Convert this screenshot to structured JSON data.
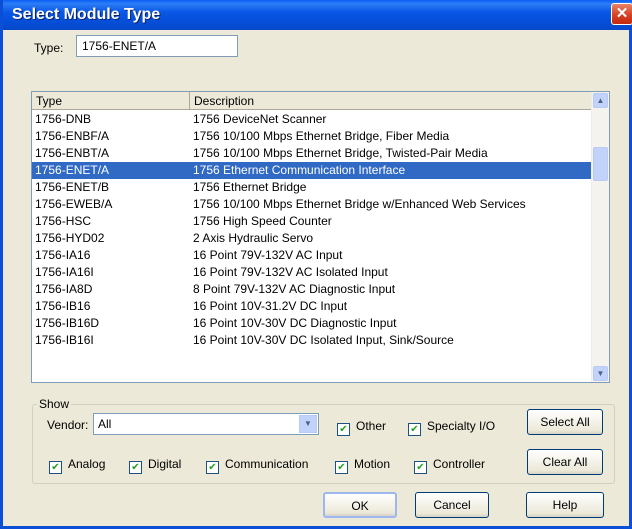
{
  "window": {
    "title": "Select Module Type",
    "close_glyph": "✕"
  },
  "type_field": {
    "label": "Type:",
    "value": "1756-ENET/A"
  },
  "list": {
    "columns": [
      "Type",
      "Description"
    ],
    "rows": [
      {
        "type": "1756-DNB",
        "desc": "1756 DeviceNet Scanner"
      },
      {
        "type": "1756-ENBF/A",
        "desc": "1756 10/100 Mbps Ethernet Bridge, Fiber Media"
      },
      {
        "type": "1756-ENBT/A",
        "desc": "1756 10/100 Mbps Ethernet Bridge, Twisted-Pair Media"
      },
      {
        "type": "1756-ENET/A",
        "desc": "1756 Ethernet Communication Interface"
      },
      {
        "type": "1756-ENET/B",
        "desc": "1756 Ethernet Bridge"
      },
      {
        "type": "1756-EWEB/A",
        "desc": "1756 10/100 Mbps Ethernet Bridge w/Enhanced Web Services"
      },
      {
        "type": "1756-HSC",
        "desc": "1756 High Speed Counter"
      },
      {
        "type": "1756-HYD02",
        "desc": "2 Axis Hydraulic Servo"
      },
      {
        "type": "1756-IA16",
        "desc": "16 Point 79V-132V AC Input"
      },
      {
        "type": "1756-IA16I",
        "desc": "16 Point 79V-132V AC Isolated Input"
      },
      {
        "type": "1756-IA8D",
        "desc": "8 Point 79V-132V AC Diagnostic Input"
      },
      {
        "type": "1756-IB16",
        "desc": "16 Point 10V-31.2V DC Input"
      },
      {
        "type": "1756-IB16D",
        "desc": "16 Point 10V-30V DC Diagnostic Input"
      },
      {
        "type": "1756-IB16I",
        "desc": "16 Point 10V-30V DC Isolated Input, Sink/Source"
      }
    ],
    "selected_index": 3
  },
  "show": {
    "legend": "Show",
    "vendor_label": "Vendor:",
    "vendor_value": "All",
    "other": "Other",
    "specialty": "Specialty I/O",
    "analog": "Analog",
    "digital": "Digital",
    "communication": "Communication",
    "motion": "Motion",
    "controller": "Controller",
    "check_glyph": "✔",
    "select_all": "Select All",
    "clear_all": "Clear All"
  },
  "buttons": {
    "ok": "OK",
    "cancel": "Cancel",
    "help": "Help"
  },
  "glyphs": {
    "up": "▲",
    "down": "▼"
  },
  "colors": {
    "title_bar": "#0a58e6",
    "selection": "#316ac5",
    "window_bg": "#ece9d8"
  }
}
